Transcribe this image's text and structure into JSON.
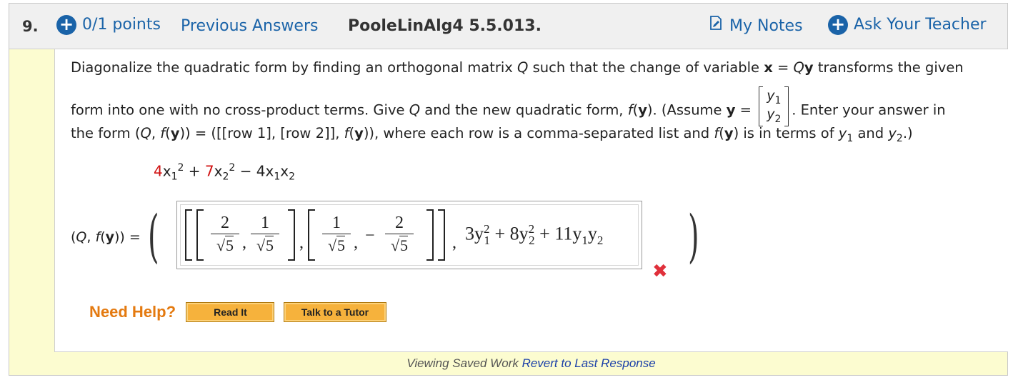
{
  "header": {
    "question_number": "9.",
    "points": "0/1 points",
    "previous_answers": "Previous Answers",
    "problem_code": "PooleLinAlg4 5.5.013.",
    "my_notes": "My Notes",
    "ask_teacher": "Ask Your Teacher"
  },
  "prompt": {
    "line1_a": "Diagonalize the quadratic form by finding an orthogonal matrix ",
    "line1_Q": "Q",
    "line1_b": " such that the change of variable ",
    "line1_x": "x",
    "line1_c": " = ",
    "line1_Qy_Q": "Q",
    "line1_Qy_y": "y",
    "line1_d": " transforms the given",
    "line2_a": "form into one with no cross-product terms. Give ",
    "line2_Q": "Q",
    "line2_b": " and the new quadratic form, ",
    "line2_f": "f",
    "line2_y": "y",
    "line2_c": "). (Assume ",
    "line2_ybold": "y",
    "line2_eq": " = ",
    "vec_y1": "y",
    "vec_y2": "y",
    "line2_d": ". Enter your answer in",
    "line3_a": "the form (",
    "line3_Q": "Q",
    "line3_b": ", ",
    "line3_f": "f",
    "line3_y": "y",
    "line3_c": ")) = ([[row 1], [row 2]], ",
    "line3_f2": "f",
    "line3_y2": "y",
    "line3_d": ")), where each row is a comma-separated list and ",
    "line3_f3": "f",
    "line3_y3": "y",
    "line3_e": ") is in terms of ",
    "line3_var1": "y",
    "line3_and": " and ",
    "line3_var2": "y",
    "line3_end": ".)"
  },
  "expression": {
    "coef1": "4",
    "coef2": "7",
    "rest": "− 4x"
  },
  "answer": {
    "label_a": "(",
    "label_Q": "Q",
    "label_b": ", ",
    "label_f": "f",
    "label_y": "y",
    "label_c": ")) =",
    "num1": "2",
    "num2": "1",
    "num3": "1",
    "num4": "2",
    "den": "5",
    "poly_a": "3y",
    "poly_b": " + 8y",
    "poly_c": " + 11y",
    "status": "incorrect"
  },
  "help": {
    "label": "Need Help?",
    "read_it": "Read It",
    "talk_tutor": "Talk to a Tutor"
  },
  "footer": {
    "viewing": "Viewing Saved Work",
    "revert": "Revert to Last Response"
  },
  "colors": {
    "link": "#1a63a8",
    "highlight": "#fcfcd0",
    "error": "#e0303b",
    "help_orange": "#e47a10",
    "button": "#f6b23c"
  }
}
